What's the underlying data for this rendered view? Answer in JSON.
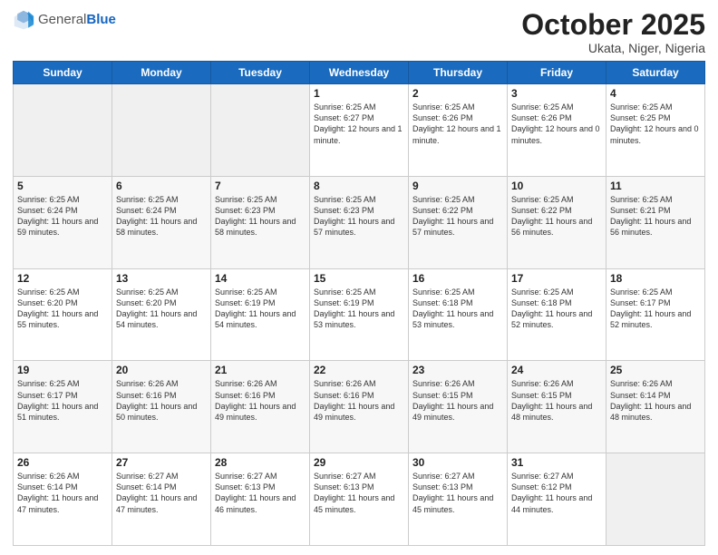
{
  "header": {
    "logo_general": "General",
    "logo_blue": "Blue",
    "month_title": "October 2025",
    "location": "Ukata, Niger, Nigeria"
  },
  "weekdays": [
    "Sunday",
    "Monday",
    "Tuesday",
    "Wednesday",
    "Thursday",
    "Friday",
    "Saturday"
  ],
  "weeks": [
    [
      {
        "day": "",
        "info": ""
      },
      {
        "day": "",
        "info": ""
      },
      {
        "day": "",
        "info": ""
      },
      {
        "day": "1",
        "info": "Sunrise: 6:25 AM\nSunset: 6:27 PM\nDaylight: 12 hours\nand 1 minute."
      },
      {
        "day": "2",
        "info": "Sunrise: 6:25 AM\nSunset: 6:26 PM\nDaylight: 12 hours\nand 1 minute."
      },
      {
        "day": "3",
        "info": "Sunrise: 6:25 AM\nSunset: 6:26 PM\nDaylight: 12 hours\nand 0 minutes."
      },
      {
        "day": "4",
        "info": "Sunrise: 6:25 AM\nSunset: 6:25 PM\nDaylight: 12 hours\nand 0 minutes."
      }
    ],
    [
      {
        "day": "5",
        "info": "Sunrise: 6:25 AM\nSunset: 6:24 PM\nDaylight: 11 hours\nand 59 minutes."
      },
      {
        "day": "6",
        "info": "Sunrise: 6:25 AM\nSunset: 6:24 PM\nDaylight: 11 hours\nand 58 minutes."
      },
      {
        "day": "7",
        "info": "Sunrise: 6:25 AM\nSunset: 6:23 PM\nDaylight: 11 hours\nand 58 minutes."
      },
      {
        "day": "8",
        "info": "Sunrise: 6:25 AM\nSunset: 6:23 PM\nDaylight: 11 hours\nand 57 minutes."
      },
      {
        "day": "9",
        "info": "Sunrise: 6:25 AM\nSunset: 6:22 PM\nDaylight: 11 hours\nand 57 minutes."
      },
      {
        "day": "10",
        "info": "Sunrise: 6:25 AM\nSunset: 6:22 PM\nDaylight: 11 hours\nand 56 minutes."
      },
      {
        "day": "11",
        "info": "Sunrise: 6:25 AM\nSunset: 6:21 PM\nDaylight: 11 hours\nand 56 minutes."
      }
    ],
    [
      {
        "day": "12",
        "info": "Sunrise: 6:25 AM\nSunset: 6:20 PM\nDaylight: 11 hours\nand 55 minutes."
      },
      {
        "day": "13",
        "info": "Sunrise: 6:25 AM\nSunset: 6:20 PM\nDaylight: 11 hours\nand 54 minutes."
      },
      {
        "day": "14",
        "info": "Sunrise: 6:25 AM\nSunset: 6:19 PM\nDaylight: 11 hours\nand 54 minutes."
      },
      {
        "day": "15",
        "info": "Sunrise: 6:25 AM\nSunset: 6:19 PM\nDaylight: 11 hours\nand 53 minutes."
      },
      {
        "day": "16",
        "info": "Sunrise: 6:25 AM\nSunset: 6:18 PM\nDaylight: 11 hours\nand 53 minutes."
      },
      {
        "day": "17",
        "info": "Sunrise: 6:25 AM\nSunset: 6:18 PM\nDaylight: 11 hours\nand 52 minutes."
      },
      {
        "day": "18",
        "info": "Sunrise: 6:25 AM\nSunset: 6:17 PM\nDaylight: 11 hours\nand 52 minutes."
      }
    ],
    [
      {
        "day": "19",
        "info": "Sunrise: 6:25 AM\nSunset: 6:17 PM\nDaylight: 11 hours\nand 51 minutes."
      },
      {
        "day": "20",
        "info": "Sunrise: 6:26 AM\nSunset: 6:16 PM\nDaylight: 11 hours\nand 50 minutes."
      },
      {
        "day": "21",
        "info": "Sunrise: 6:26 AM\nSunset: 6:16 PM\nDaylight: 11 hours\nand 49 minutes."
      },
      {
        "day": "22",
        "info": "Sunrise: 6:26 AM\nSunset: 6:16 PM\nDaylight: 11 hours\nand 49 minutes."
      },
      {
        "day": "23",
        "info": "Sunrise: 6:26 AM\nSunset: 6:15 PM\nDaylight: 11 hours\nand 49 minutes."
      },
      {
        "day": "24",
        "info": "Sunrise: 6:26 AM\nSunset: 6:15 PM\nDaylight: 11 hours\nand 48 minutes."
      },
      {
        "day": "25",
        "info": "Sunrise: 6:26 AM\nSunset: 6:14 PM\nDaylight: 11 hours\nand 48 minutes."
      }
    ],
    [
      {
        "day": "26",
        "info": "Sunrise: 6:26 AM\nSunset: 6:14 PM\nDaylight: 11 hours\nand 47 minutes."
      },
      {
        "day": "27",
        "info": "Sunrise: 6:27 AM\nSunset: 6:14 PM\nDaylight: 11 hours\nand 47 minutes."
      },
      {
        "day": "28",
        "info": "Sunrise: 6:27 AM\nSunset: 6:13 PM\nDaylight: 11 hours\nand 46 minutes."
      },
      {
        "day": "29",
        "info": "Sunrise: 6:27 AM\nSunset: 6:13 PM\nDaylight: 11 hours\nand 45 minutes."
      },
      {
        "day": "30",
        "info": "Sunrise: 6:27 AM\nSunset: 6:13 PM\nDaylight: 11 hours\nand 45 minutes."
      },
      {
        "day": "31",
        "info": "Sunrise: 6:27 AM\nSunset: 6:12 PM\nDaylight: 11 hours\nand 44 minutes."
      },
      {
        "day": "",
        "info": ""
      }
    ]
  ]
}
